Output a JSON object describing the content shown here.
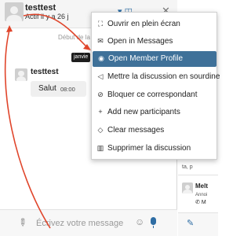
{
  "chat": {
    "header": {
      "name": "testtest",
      "status": "Actif il y a 26 j",
      "close_icon": "close-icon"
    },
    "day_separator": "Début de la",
    "date_tooltip": "janvie",
    "message": {
      "author": "testtest",
      "text": "Salut",
      "time": "08:00"
    },
    "composer": {
      "placeholder": "Écrivez votre message",
      "attach_icon": "paperclip-icon",
      "emoji_icon": "smiley-icon",
      "mic_icon": "microphone-icon"
    }
  },
  "menu": {
    "items": [
      {
        "icon": "fullscreen-icon",
        "glyph": "⛶",
        "label": "Ouvrir en plein écran"
      },
      {
        "icon": "inbox-icon",
        "glyph": "✉",
        "label": "Open in Messages"
      },
      {
        "icon": "user-circle-icon",
        "glyph": "◉",
        "label": "Open Member Profile",
        "active": true
      },
      {
        "icon": "mute-icon",
        "glyph": "◁",
        "label": "Mettre la discussion en sourdine"
      },
      {
        "icon": "block-icon",
        "glyph": "⊘",
        "label": "Bloquer ce correspondant"
      },
      {
        "icon": "add-user-icon",
        "glyph": "+",
        "label": "Add new participants"
      },
      {
        "icon": "clear-icon",
        "glyph": "◇",
        "label": "Clear messages"
      },
      {
        "icon": "trash-icon",
        "glyph": "▥",
        "label": "Supprimer la discussion"
      }
    ]
  },
  "side": {
    "fragment": "ta, p",
    "contact_name": "Melt",
    "contact_sub": "Annoi",
    "contact_phone": "M"
  },
  "colors": {
    "accent": "#2e6da4",
    "menu_highlight": "#3f7199",
    "arrow": "#e0452b"
  }
}
